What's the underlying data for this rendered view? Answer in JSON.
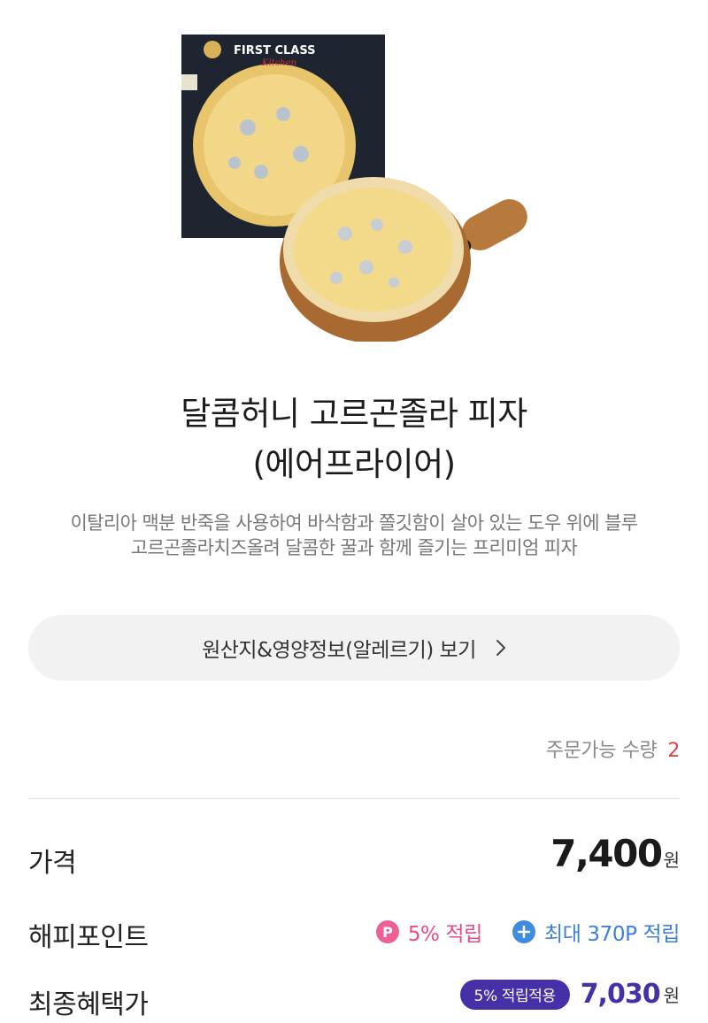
{
  "product": {
    "box_brand_line1": "FIRST CLASS",
    "box_brand_line2": "Kitchen",
    "title_line1": "달콤허니 고르곤졸라 피자",
    "title_line2": "(에어프라이어)",
    "description_line1": "이탈리아 맥분 반죽을 사용하여 바삭함과 쫄깃함이 살아 있는 도우 위에 블루",
    "description_line2": "고르곤졸라치즈올려 달콤한 꿀과 함께 즐기는 프리미엄 피자"
  },
  "info_button": {
    "label": "원산지&영양정보(알레르기) 보기",
    "icon": "chevron-right-icon"
  },
  "order": {
    "label": "주문가능 수량",
    "quantity": "2"
  },
  "price": {
    "label": "가격",
    "value": "7,400",
    "unit": "원"
  },
  "happy_point": {
    "label": "해피포인트",
    "badge_letter": "P",
    "rate_text": "5% 적립",
    "max_text": "최대 370P 적립",
    "icon": "plus-circle-icon"
  },
  "final_price": {
    "label": "최종혜택가",
    "badge": "5% 적립적용",
    "value": "7,030",
    "unit": "원"
  },
  "colors": {
    "accent_purple": "#4630a8",
    "point_pink": "#e94b8a",
    "point_blue": "#3f7fd8",
    "quantity_red": "#e0424a"
  }
}
